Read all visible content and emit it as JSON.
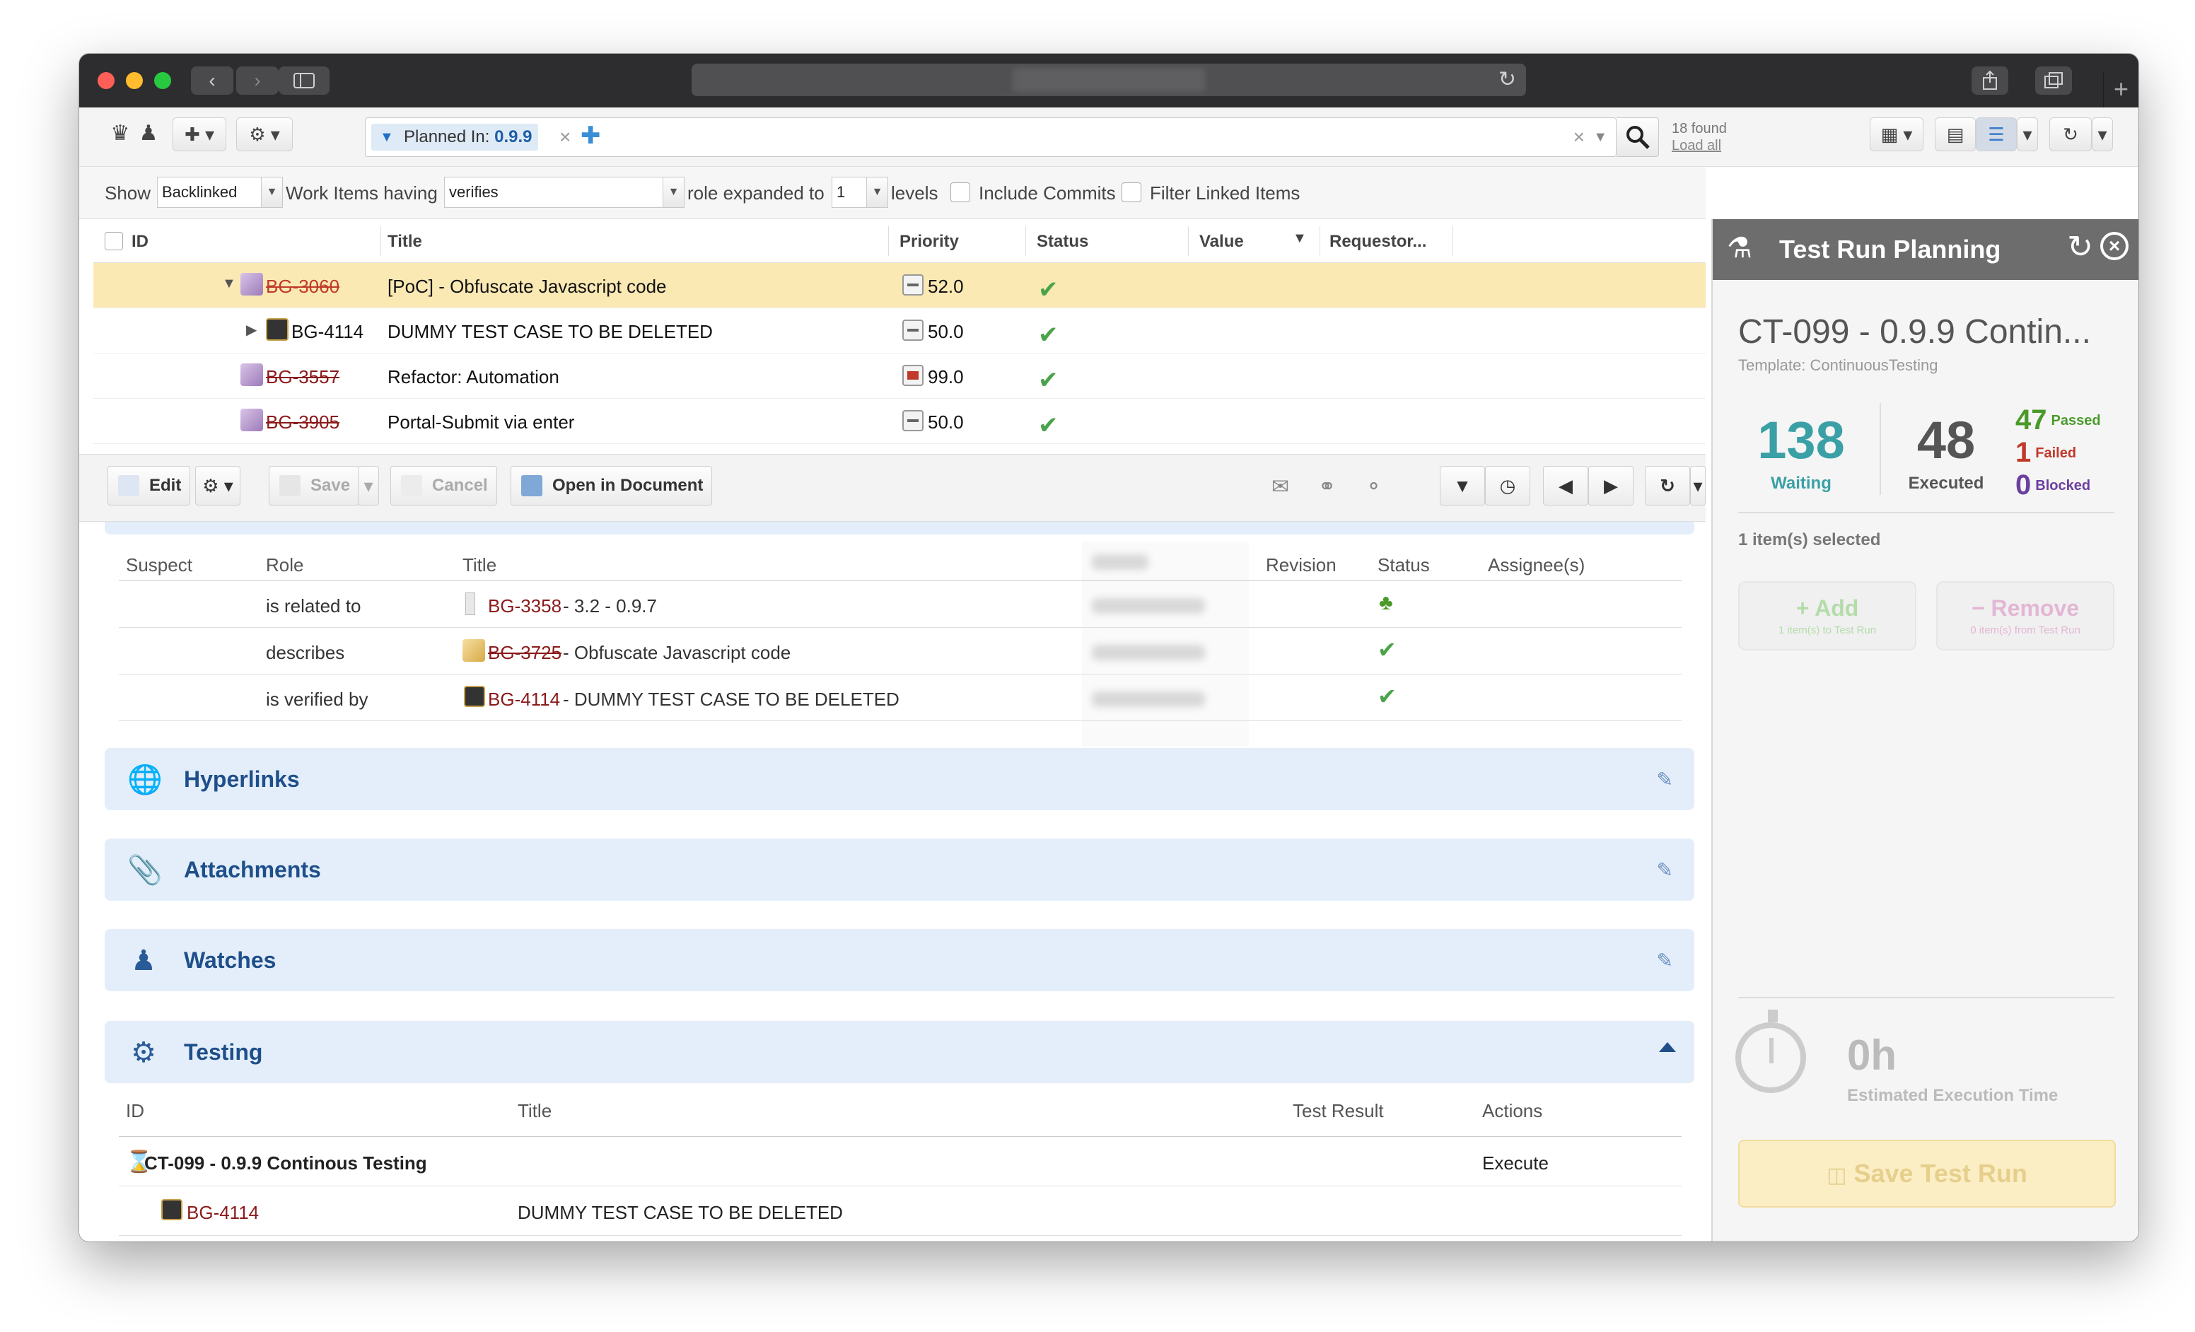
{
  "browser": {
    "controls": {
      "back": "‹",
      "forward": "›",
      "reload": "↻",
      "new_tab": "+"
    }
  },
  "toolbar": {
    "query_chip": {
      "label": "Planned In: ",
      "value": "0.9.9"
    },
    "found": "18 found",
    "load_all": "Load all"
  },
  "filterbar": {
    "show_label": "Show",
    "show_value": "Backlinked",
    "work_items_label": "Work Items having",
    "role_value": "verifies",
    "role_expanded_label": "role expanded to",
    "levels_value": "1",
    "levels_label": "levels",
    "include_commits": "Include Commits",
    "filter_linked": "Filter Linked Items"
  },
  "work_items": {
    "columns": [
      "ID",
      "Title",
      "Priority",
      "Status",
      "Value",
      "Requestor..."
    ],
    "rows": [
      {
        "id": "BG-3060",
        "title": "[PoC] - Obfuscate Javascript code",
        "priority": "52.0"
      },
      {
        "id": "BG-4114",
        "title": "DUMMY TEST CASE TO BE DELETED",
        "priority": "50.0"
      },
      {
        "id": "BG-3557",
        "title": "Refactor: Automation",
        "priority": "99.0"
      },
      {
        "id": "BG-3905",
        "title": "Portal-Submit via enter",
        "priority": "50.0"
      }
    ]
  },
  "actionbar": {
    "edit": "Edit",
    "save": "Save",
    "cancel": "Cancel",
    "open_in_document": "Open in Document"
  },
  "linked_items": {
    "columns": [
      "Suspect",
      "Role",
      "Title",
      "Revision",
      "Status",
      "Assignee(s)"
    ],
    "rows": [
      {
        "role": "is related to",
        "id": "BG-3358",
        "title": " - 3.2 - 0.9.7"
      },
      {
        "role": "describes",
        "id": "BG-3725",
        "title": " - Obfuscate Javascript code"
      },
      {
        "role": "is verified by",
        "id": "BG-4114",
        "title": " - DUMMY TEST CASE TO BE DELETED"
      }
    ]
  },
  "sections": {
    "hyperlinks": "Hyperlinks",
    "attachments": "Attachments",
    "watches": "Watches",
    "testing": "Testing"
  },
  "testing": {
    "columns": [
      "ID",
      "Title",
      "Test Result",
      "Actions"
    ],
    "run": {
      "name": "CT-099 - 0.9.9 Continous Testing",
      "action": "Execute"
    },
    "case": {
      "id": "BG-4114",
      "title": "DUMMY TEST CASE TO BE DELETED"
    }
  },
  "test_run_planning": {
    "header": "Test Run Planning",
    "title": "CT-099 - 0.9.9 Contin...",
    "template": "Template: ContinuousTesting",
    "waiting": {
      "value": "138",
      "label": "Waiting"
    },
    "executed": {
      "value": "48",
      "label": "Executed"
    },
    "passed": {
      "value": "47",
      "label": "Passed"
    },
    "failed": {
      "value": "1",
      "label": "Failed"
    },
    "blocked": {
      "value": "0",
      "label": "Blocked"
    },
    "selected": "1 item(s) selected",
    "add": {
      "label": "+ Add",
      "sub": "1 item(s) to Test Run"
    },
    "remove": {
      "label": "− Remove",
      "sub": "0 item(s) from Test Run"
    },
    "estimate": {
      "value": "0h",
      "label": "Estimated Execution Time"
    },
    "save": "Save Test Run"
  },
  "colors": {
    "accent_blue": "#1f4f8a",
    "waiting_teal": "#3aa0a6",
    "passed_green": "#4a9a2a",
    "failed_red": "#c0392b",
    "blocked_purple": "#6a3fa0",
    "selected_row": "#fbe9b4"
  }
}
